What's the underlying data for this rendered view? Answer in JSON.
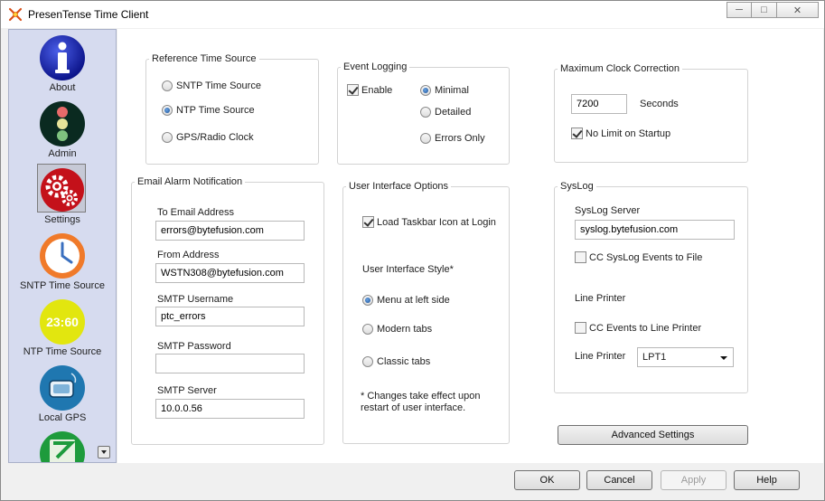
{
  "window": {
    "title": "PresenTense Time Client"
  },
  "sidebar": {
    "items": [
      {
        "label": "About",
        "icon": "info-icon"
      },
      {
        "label": "Admin",
        "icon": "traffic-light-icon"
      },
      {
        "label": "Settings",
        "icon": "gears-icon",
        "selected": true
      },
      {
        "label": "SNTP Time Source",
        "icon": "clock-icon"
      },
      {
        "label": "NTP Time Source",
        "icon": "digital-clock-icon",
        "clock_text": "23:60"
      },
      {
        "label": "Local GPS",
        "icon": "gps-icon"
      },
      {
        "label": "",
        "icon": "timezone-icon"
      }
    ]
  },
  "reference_time_source": {
    "legend": "Reference Time Source",
    "options": [
      "SNTP Time Source",
      "NTP Time Source",
      "GPS/Radio Clock"
    ],
    "selected": "NTP Time Source"
  },
  "event_logging": {
    "legend": "Event Logging",
    "enable_label": "Enable",
    "enable_checked": true,
    "levels": [
      "Minimal",
      "Detailed",
      "Errors Only"
    ],
    "selected": "Minimal"
  },
  "max_clock_correction": {
    "legend": "Maximum Clock Correction",
    "value": "7200",
    "unit_label": "Seconds",
    "no_limit_label": "No Limit on Startup",
    "no_limit_checked": true
  },
  "email_alarm": {
    "legend": "Email Alarm Notification",
    "to_label": "To Email Address",
    "to_value": "errors@bytefusion.com",
    "from_label": "From Address",
    "from_value": "WSTN308@bytefusion.com",
    "username_label": "SMTP Username",
    "username_value": "ptc_errors",
    "password_label": "SMTP Password",
    "password_value": "",
    "server_label": "SMTP Server",
    "server_value": "10.0.0.56"
  },
  "ui_options": {
    "legend": "User Interface Options",
    "taskbar_label": "Load Taskbar Icon at Login",
    "taskbar_checked": true,
    "style_label": "User Interface Style*",
    "styles": [
      "Menu at left side",
      "Modern tabs",
      "Classic tabs"
    ],
    "selected": "Menu at left side",
    "note_line1": "* Changes take effect upon",
    "note_line2": "restart of user interface."
  },
  "syslog": {
    "legend": "SysLog",
    "server_label": "SysLog Server",
    "server_value": "syslog.bytefusion.com",
    "cc_file_label": "CC SysLog Events to File",
    "cc_file_checked": false,
    "line_printer_heading": "Line Printer",
    "cc_printer_label": "CC Events to Line Printer",
    "cc_printer_checked": false,
    "printer_label": "Line Printer",
    "printer_value": "LPT1"
  },
  "advanced_button": "Advanced Settings",
  "footer": {
    "ok": "OK",
    "cancel": "Cancel",
    "apply": "Apply",
    "help": "Help"
  },
  "colors": {
    "sidebar_bg": "#d6dbef",
    "radio_accent": "#1a4f95"
  }
}
